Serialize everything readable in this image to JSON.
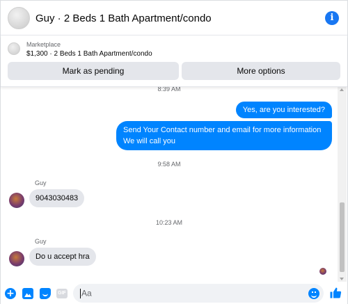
{
  "header": {
    "title": "Guy · 2 Beds 1 Bath Apartment/condo",
    "info_glyph": "i"
  },
  "marketplace": {
    "label": "Marketplace",
    "listing": "$1,300 · 2 Beds 1 Bath Apartment/condo",
    "mark_pending_label": "Mark as pending",
    "more_options_label": "More options"
  },
  "messages": {
    "timestamp_1": "8:39 AM",
    "outgoing_1": "Yes, are you interested?",
    "outgoing_2": "Send Your Contact number and email for more information We will call you",
    "timestamp_2": "9:58 AM",
    "sender_1": "Guy",
    "incoming_1": "9043030483",
    "timestamp_3": "10:23 AM",
    "sender_2": "Guy",
    "incoming_2": "Do u accept hra"
  },
  "composer": {
    "placeholder": "Aa",
    "plus_glyph": "+",
    "gif_label": "GIF"
  },
  "icons": {
    "info": "info-icon",
    "plus": "plus-icon",
    "photo": "photo-icon",
    "sticker": "sticker-icon",
    "gif": "gif-icon",
    "emoji": "emoji-icon",
    "like": "like-icon"
  },
  "colors": {
    "accent": "#0084ff",
    "brand_blue": "#1877f2",
    "incoming_bubble": "#e4e6eb",
    "button_bg": "#e4e6eb",
    "secondary_text": "#65676b"
  }
}
